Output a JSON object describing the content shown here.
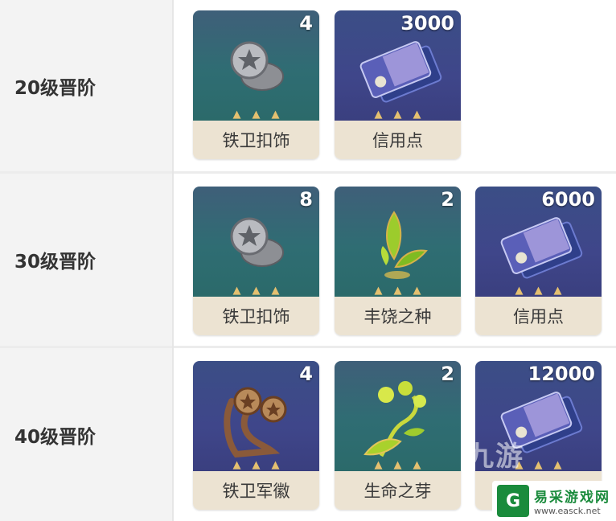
{
  "rows": [
    {
      "label": "20级晋阶",
      "items": [
        {
          "name": "铁卫扣饰",
          "qty": "4",
          "icon": "silver-coin-icon",
          "bg": "teal"
        },
        {
          "name": "信用点",
          "qty": "3000",
          "icon": "credit-card-icon",
          "bg": "purple"
        }
      ]
    },
    {
      "label": "30级晋阶",
      "items": [
        {
          "name": "铁卫扣饰",
          "qty": "8",
          "icon": "silver-coin-icon",
          "bg": "teal"
        },
        {
          "name": "丰饶之种",
          "qty": "2",
          "icon": "seed-icon",
          "bg": "teal"
        },
        {
          "name": "信用点",
          "qty": "6000",
          "icon": "credit-card-icon",
          "bg": "purple"
        }
      ]
    },
    {
      "label": "40级晋阶",
      "items": [
        {
          "name": "铁卫军徽",
          "qty": "4",
          "icon": "bronze-badge-icon",
          "bg": "purple"
        },
        {
          "name": "生命之芽",
          "qty": "2",
          "icon": "sprout-icon",
          "bg": "teal"
        },
        {
          "name": "信用点",
          "qty": "12000",
          "icon": "credit-card-icon",
          "bg": "purple"
        }
      ]
    }
  ],
  "watermark": {
    "overlay_text": "九游",
    "site_name": "易采游戏网",
    "site_url": "www.easck.net",
    "logo_glyph": "G",
    "logo_color": "#1a8b3c"
  }
}
